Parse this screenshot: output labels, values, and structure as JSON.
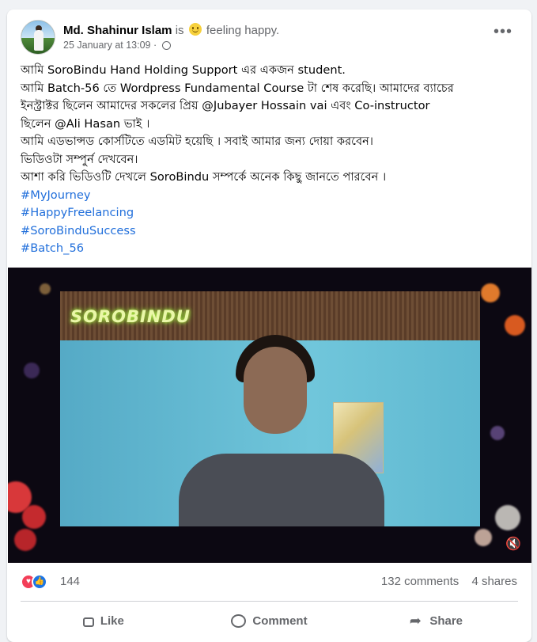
{
  "post": {
    "author": "Md. Shahinur Islam",
    "is_text": "is",
    "feeling": "feeling happy.",
    "timestamp": "25 January at 13:09",
    "meta_dot": "·",
    "more_label": "•••",
    "lines": [
      "আমি SoroBindu Hand Holding Support  এর একজন student.",
      "আমি Batch-56 তে Wordpress Fundamental Course টা শেষ করেছি।  আমাদের ব্যাচের",
      "ইনস্ট্রাক্টর ছিলেন আমাদের সকলের প্রিয় @Jubayer Hossain vai  এবং Co-instructor",
      "ছিলেন @Ali Hasan ভাই ।",
      " আমি এডভান্সড কোর্সটিতে এডমিট  হয়েছি । সবাই আমার জন্য দোয়া করবেন।",
      "ভিডিওটা সম্পুর্ন দেখবেন।",
      "আশা করি ভিডিওটি দেখলে SoroBindu সম্পর্কে অনেক কিছু জানতে পারবেন ।"
    ],
    "hashtags": [
      "#MyJourney",
      "#HappyFreelancing",
      "#SoroBinduSuccess",
      "#Batch_56"
    ]
  },
  "video": {
    "logo_text": "SOROBINDU",
    "mute_icon": "🔇"
  },
  "engagement": {
    "reaction_count": "144",
    "comments": "132 comments",
    "shares": "4 shares"
  },
  "actions": {
    "like": "Like",
    "comment": "Comment",
    "share": "Share"
  },
  "colors": {
    "link": "#216fdb",
    "love": "#f33e58",
    "like": "#1b74e4",
    "secondary_text": "#65676b"
  },
  "icons": [
    "more-options-icon",
    "globe-icon",
    "smile-emoji-icon",
    "love-reaction-icon",
    "like-reaction-icon",
    "mute-icon",
    "like-icon",
    "comment-icon",
    "share-icon"
  ]
}
